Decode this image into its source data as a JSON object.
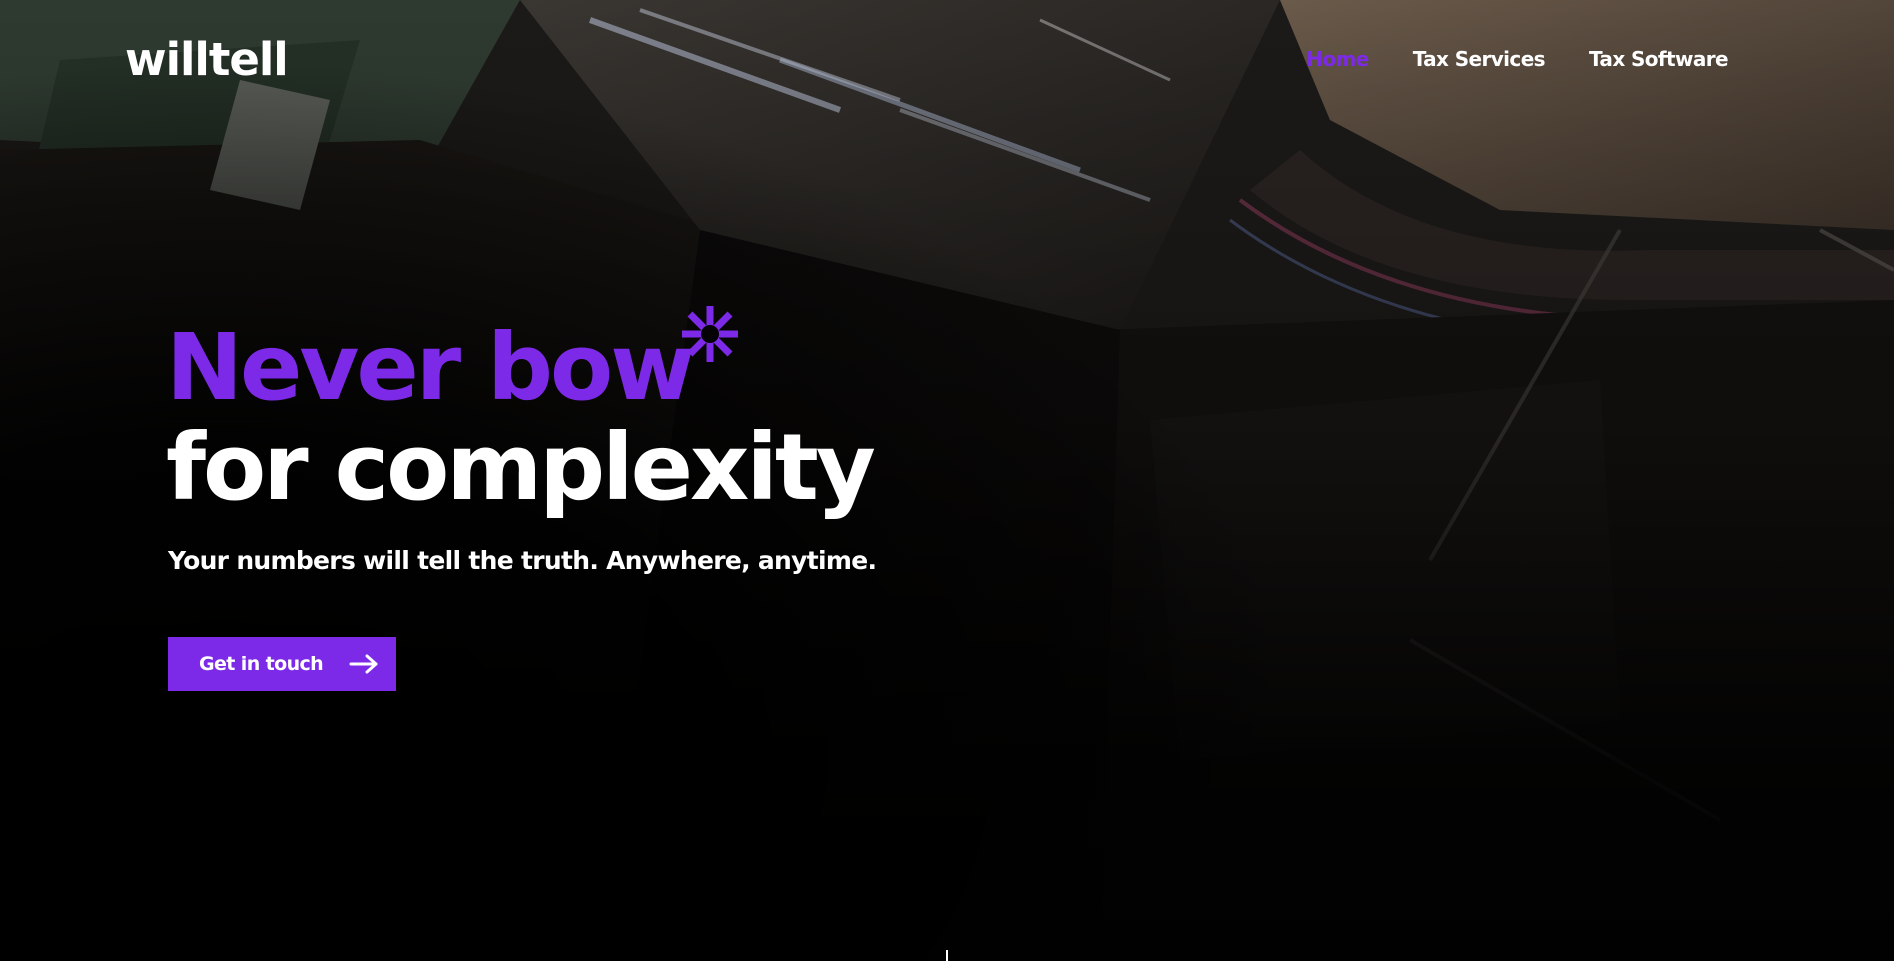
{
  "brand": {
    "logo_text": "willtell",
    "accent_color": "#7d2ae8"
  },
  "nav": {
    "items": [
      {
        "label": "Home",
        "active": true
      },
      {
        "label": "Tax Services",
        "active": false
      },
      {
        "label": "Tax Software",
        "active": false
      }
    ]
  },
  "hero": {
    "headline_line1": "Never bow",
    "headline_line2": "for complexity",
    "asterisk_icon": "asterisk-icon",
    "subheadline": "Your numbers will tell the truth. Anywhere, anytime.",
    "cta_label": "Get in touch",
    "cta_icon": "arrow-right-icon"
  }
}
